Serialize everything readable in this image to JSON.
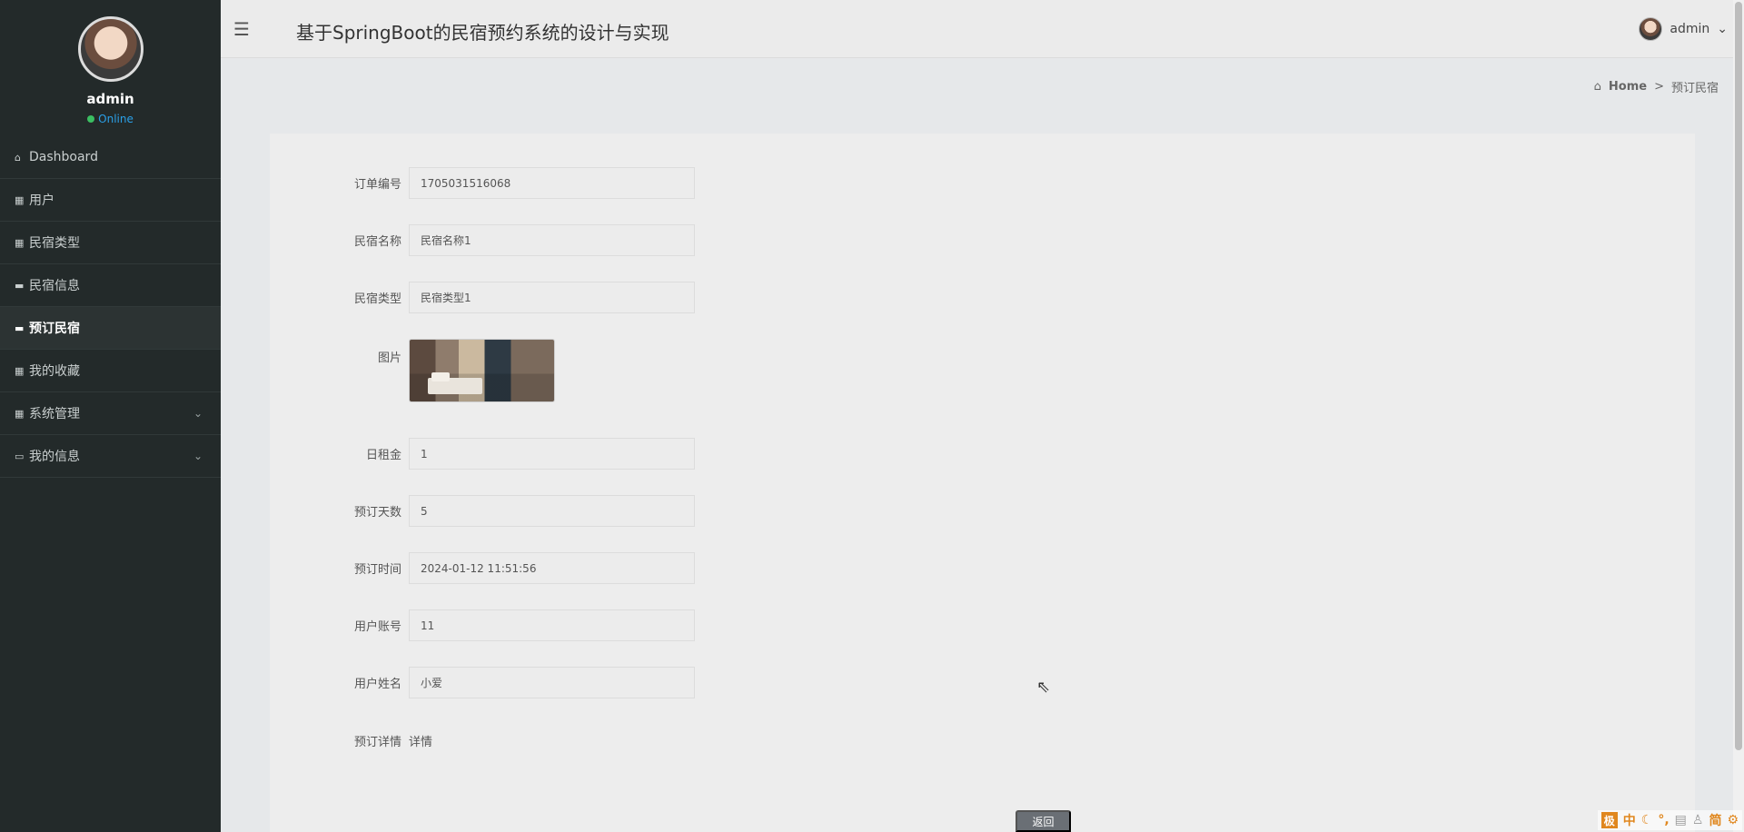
{
  "sidebar": {
    "user": {
      "name": "admin",
      "status": "Online"
    },
    "menu": [
      {
        "icon": "home-icon",
        "label": "Dashboard",
        "active": false,
        "expandable": false
      },
      {
        "icon": "grid-icon",
        "label": "用户",
        "active": false,
        "expandable": false
      },
      {
        "icon": "grid-icon",
        "label": "民宿类型",
        "active": false,
        "expandable": false
      },
      {
        "icon": "comment-icon",
        "label": "民宿信息",
        "active": false,
        "expandable": false
      },
      {
        "icon": "comment-icon",
        "label": "预订民宿",
        "active": true,
        "expandable": false
      },
      {
        "icon": "grid-icon",
        "label": "我的收藏",
        "active": false,
        "expandable": false
      },
      {
        "icon": "grid-icon",
        "label": "系统管理",
        "active": false,
        "expandable": true
      },
      {
        "icon": "window-icon",
        "label": "我的信息",
        "active": false,
        "expandable": true
      }
    ]
  },
  "header": {
    "title": "基于SpringBoot的民宿预约系统的设计与实现",
    "user": "admin"
  },
  "breadcrumb": {
    "home": "Home",
    "separator": ">",
    "current": "预订民宿"
  },
  "form": {
    "order_no": {
      "label": "订单编号",
      "value": "1705031516068"
    },
    "name": {
      "label": "民宿名称",
      "value": "民宿名称1"
    },
    "type": {
      "label": "民宿类型",
      "value": "民宿类型1"
    },
    "image": {
      "label": "图片"
    },
    "daily_rent": {
      "label": "日租金",
      "value": "1"
    },
    "days": {
      "label": "预订天数",
      "value": "5"
    },
    "time": {
      "label": "预订时间",
      "value": "2024-01-12 11:51:56"
    },
    "account": {
      "label": "用户账号",
      "value": "11"
    },
    "username": {
      "label": "用户姓名",
      "value": "小爱"
    },
    "detail": {
      "label": "预订详情",
      "value": "详情"
    }
  },
  "back_label": "返回",
  "ime": {
    "logo": "极",
    "lang": "中",
    "simplified": "简"
  },
  "colors": {
    "sidebar_bg": "#232a2a",
    "accent_online": "#3bbf62",
    "ime_orange": "#e0871e"
  }
}
